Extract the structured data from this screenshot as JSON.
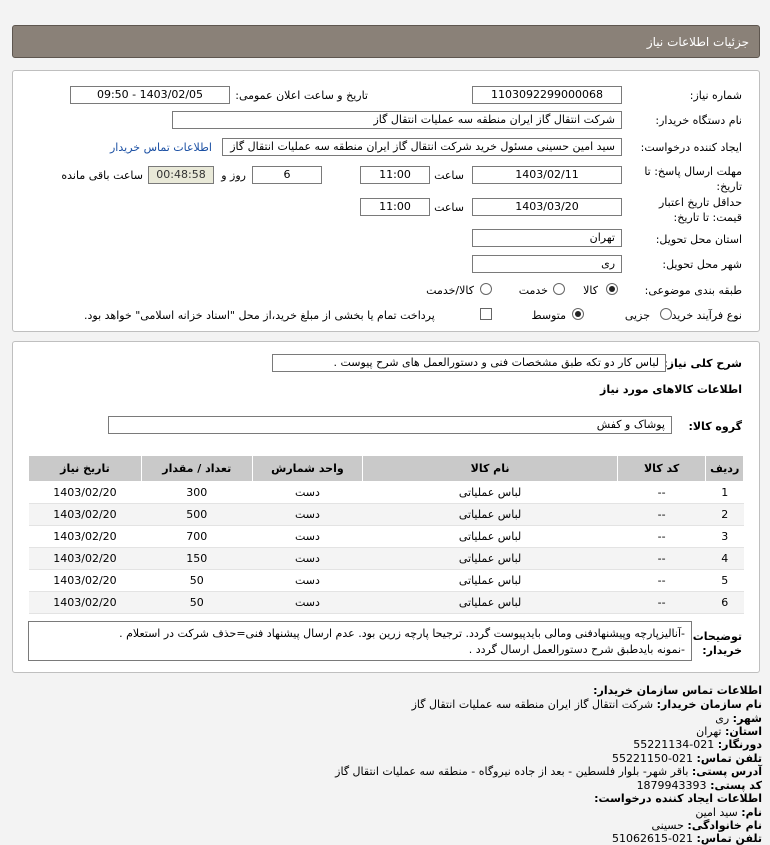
{
  "page_title": "جزئیات اطلاعات نیاز",
  "form": {
    "need_number_label": "شماره نیاز:",
    "need_number": "1103092299000068",
    "announce_label": "تاریخ و ساعت اعلان عمومی:",
    "announce_value": "1403/02/05 - 09:50",
    "buyer_label": "نام دستگاه خریدار:",
    "buyer_value": "شرکت انتقال گاز ایران منطقه سه عملیات انتقال گاز",
    "creator_label": "ایجاد کننده درخواست:",
    "creator_value": "سید امین حسینی مسئول خرید شرکت انتقال گاز ایران منطقه سه عملیات انتقال گاز",
    "contact_link": "اطلاعات تماس خریدار",
    "reply_label": "مهلت ارسال پاسخ: تا تاریخ:",
    "reply_date": "1403/02/11",
    "time_label": "ساعت",
    "reply_time": "11:00",
    "days": "6",
    "days_label": "روز و",
    "remaining_time": "00:48:58",
    "remaining_label": "ساعت باقی مانده",
    "validity_label": "حداقل تاریخ اعتبار قیمت: تا تاریخ:",
    "validity_date": "1403/03/20",
    "validity_time": "11:00",
    "province_label": "استان محل تحویل:",
    "province_value": "تهران",
    "city_label": "شهر محل تحویل:",
    "city_value": "ری",
    "category_label": "طبقه بندی موضوعی:",
    "cat_goods": "کالا",
    "cat_service": "خدمت",
    "cat_goods_service": "کالا/خدمت",
    "process_label": "نوع فرآیند خرید :",
    "proc_partial": "جزیی",
    "proc_medium": "متوسط",
    "payment_note": "پرداخت تمام یا بخشی از مبلغ خرید،از محل \"اسناد خزانه اسلامی\" خواهد بود."
  },
  "need": {
    "summary_label": "شرح کلی نیاز:",
    "summary_value": "لباس کار دو تکه طبق مشخصات فنی و دستورالعمل های شرح پیوست .",
    "goods_info_title": "اطلاعات کالاهای مورد نیاز",
    "goods_group_label": "گروه کالا:",
    "goods_group_value": "پوشاک و کفش"
  },
  "table": {
    "headers": [
      "ردیف",
      "کد کالا",
      "نام کالا",
      "واحد شمارش",
      "تعداد / مقدار",
      "تاریخ نیاز"
    ],
    "rows": [
      [
        "1",
        "--",
        "لباس عملیاتی",
        "دست",
        "300",
        "1403/02/20"
      ],
      [
        "2",
        "--",
        "لباس عملیاتی",
        "دست",
        "500",
        "1403/02/20"
      ],
      [
        "3",
        "--",
        "لباس عملیاتی",
        "دست",
        "700",
        "1403/02/20"
      ],
      [
        "4",
        "--",
        "لباس عملیاتی",
        "دست",
        "150",
        "1403/02/20"
      ],
      [
        "5",
        "--",
        "لباس عملیاتی",
        "دست",
        "50",
        "1403/02/20"
      ],
      [
        "6",
        "--",
        "لباس عملیاتی",
        "دست",
        "50",
        "1403/02/20"
      ]
    ]
  },
  "buyer_notes": {
    "label": "توضیحات خریدار:",
    "line1": "-آنالیزپارچه وپیشنهادفنی ومالی بایدپیوست گردد. ترجیحا پارچه زرین بود. عدم ارسال پیشنهاد فنی=حذف شرکت در استعلام .",
    "line2": "-نمونه بایدطبق شرح دستورالعمل ارسال گردد ."
  },
  "contact": {
    "title": "اطلاعات تماس سازمان خریدار:",
    "org_label": "نام سازمان خریدار:",
    "org_value": "شرکت انتقال گاز ایران منطقه سه عملیات انتقال گاز",
    "city_label": "شهر:",
    "city_value": "ری",
    "province_label": "استان:",
    "province_value": "تهران",
    "fax_label": "دورنگار:",
    "fax_value": "021-55221134",
    "phone_label": "تلفن تماس:",
    "phone_value": "021-55221150",
    "address_label": "آدرس پستی:",
    "address_value": "باقر شهر- بلوار فلسطین - بعد از جاده نیروگاه - منطقه سه عملیات انتقال گاز",
    "postal_label": "کد پستی:",
    "postal_value": "1879943393",
    "creator_title": "اطلاعات ایجاد کننده درخواست:",
    "name_label": "نام:",
    "name_value": "سید امین",
    "family_label": "نام خانوادگی:",
    "family_value": "حسینی",
    "creator_phone_label": "تلفن تماس:",
    "creator_phone_value": "021-51062615"
  }
}
